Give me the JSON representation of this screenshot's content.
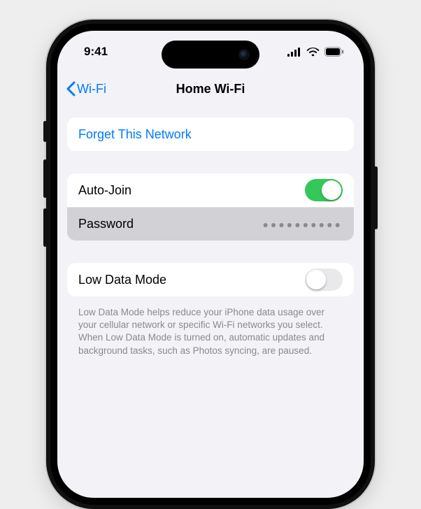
{
  "status": {
    "time": "9:41"
  },
  "nav": {
    "back_label": "Wi-Fi",
    "title": "Home Wi-Fi"
  },
  "forget": {
    "label": "Forget This Network"
  },
  "autojoin": {
    "label": "Auto-Join",
    "on": true
  },
  "password": {
    "label": "Password",
    "mask": "●●●●●●●●●●"
  },
  "lowdata": {
    "label": "Low Data Mode",
    "on": false,
    "description": "Low Data Mode helps reduce your iPhone data usage over your cellular network or specific Wi-Fi networks you select. When Low Data Mode is turned on, automatic updates and background tasks, such as Photos syncing, are paused."
  }
}
